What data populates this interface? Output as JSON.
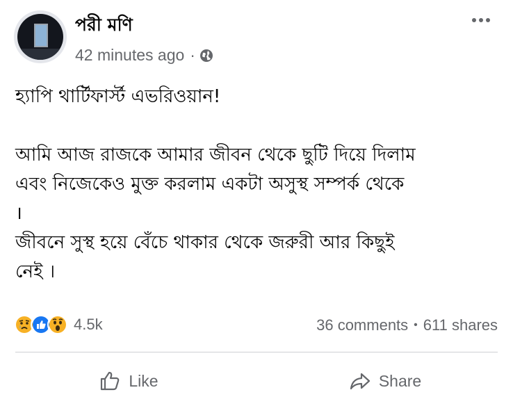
{
  "post": {
    "author_name": "পরী মণি",
    "timestamp": "42 minutes ago",
    "separator": "·",
    "privacy_icon": "globe-icon",
    "more_icon": "more-options-icon",
    "text_lines": {
      "line1": "হ্যাপি থার্টিফার্স্ট এভরিওয়ান!",
      "line2": "আমি আজ রাজকে আমার জীবন থেকে ছুটি দিয়ে দিলাম",
      "line3": "এবং নিজেকেও মুক্ত করলাম একটা অসুস্থ সম্পর্ক থেকে",
      "line4": "।",
      "line5": "জীবনে সুস্থ হয়ে বেঁচে থাকার থেকে জরুরী আর কিছুই",
      "line6": "নেই ।"
    }
  },
  "reactions": {
    "icons": [
      "sad-icon",
      "like-icon",
      "wow-icon"
    ],
    "count": "4.5k"
  },
  "stats": {
    "comments": "36 comments",
    "separator": "•",
    "shares": "611 shares"
  },
  "actions": {
    "like_label": "Like",
    "share_label": "Share"
  },
  "colors": {
    "text_primary": "#050505",
    "text_secondary": "#65676b",
    "like_blue": "#1877f2",
    "reaction_yellow": "#f7b125",
    "divider": "#ced0d4"
  }
}
